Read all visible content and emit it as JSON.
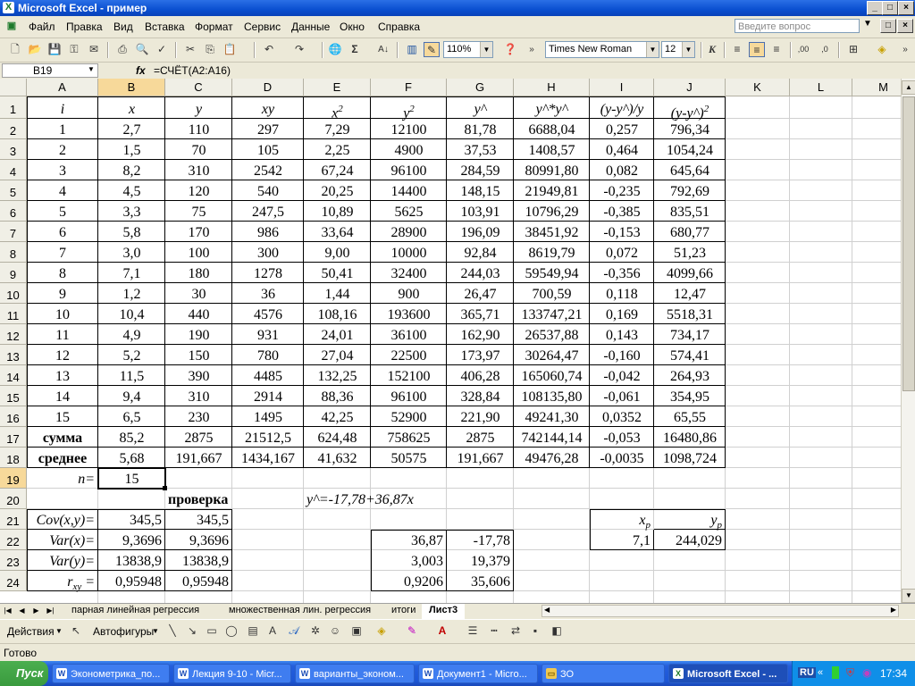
{
  "window": {
    "title": "Microsoft Excel - пример",
    "app_icon": "excel-icon"
  },
  "menu": [
    "Файл",
    "Правка",
    "Вид",
    "Вставка",
    "Формат",
    "Сервис",
    "Данные",
    "Окно",
    "Справка"
  ],
  "help_placeholder": "Введите вопрос",
  "toolbar": {
    "zoom": "110%",
    "font": "Times New Roman",
    "size": "12"
  },
  "formula_bar": {
    "name_box": "B19",
    "fx": "fx",
    "formula": "=СЧЁТ(A2:A16)"
  },
  "columns": [
    "A",
    "B",
    "C",
    "D",
    "E",
    "F",
    "G",
    "H",
    "I",
    "J",
    "K",
    "L",
    "M"
  ],
  "rows": [
    "1",
    "2",
    "3",
    "4",
    "5",
    "6",
    "7",
    "8",
    "9",
    "10",
    "11",
    "12",
    "13",
    "14",
    "15",
    "16",
    "17",
    "18",
    "19",
    "20",
    "21",
    "22",
    "23",
    "24"
  ],
  "table_header": {
    "A": "i",
    "B": "x",
    "C": "y",
    "D": "xy",
    "E": "x",
    "E_sup": "2",
    "F": "y",
    "F_sup": "2",
    "G": "y^",
    "H": "y^*y^",
    "I": "(y-y^)/y",
    "J": "(y-y^)",
    "J_sup": "2"
  },
  "table_rows": [
    [
      "1",
      "2,7",
      "110",
      "297",
      "7,29",
      "12100",
      "81,78",
      "6688,04",
      "0,257",
      "796,34"
    ],
    [
      "2",
      "1,5",
      "70",
      "105",
      "2,25",
      "4900",
      "37,53",
      "1408,57",
      "0,464",
      "1054,24"
    ],
    [
      "3",
      "8,2",
      "310",
      "2542",
      "67,24",
      "96100",
      "284,59",
      "80991,80",
      "0,082",
      "645,64"
    ],
    [
      "4",
      "4,5",
      "120",
      "540",
      "20,25",
      "14400",
      "148,15",
      "21949,81",
      "-0,235",
      "792,69"
    ],
    [
      "5",
      "3,3",
      "75",
      "247,5",
      "10,89",
      "5625",
      "103,91",
      "10796,29",
      "-0,385",
      "835,51"
    ],
    [
      "6",
      "5,8",
      "170",
      "986",
      "33,64",
      "28900",
      "196,09",
      "38451,92",
      "-0,153",
      "680,77"
    ],
    [
      "7",
      "3,0",
      "100",
      "300",
      "9,00",
      "10000",
      "92,84",
      "8619,79",
      "0,072",
      "51,23"
    ],
    [
      "8",
      "7,1",
      "180",
      "1278",
      "50,41",
      "32400",
      "244,03",
      "59549,94",
      "-0,356",
      "4099,66"
    ],
    [
      "9",
      "1,2",
      "30",
      "36",
      "1,44",
      "900",
      "26,47",
      "700,59",
      "0,118",
      "12,47"
    ],
    [
      "10",
      "10,4",
      "440",
      "4576",
      "108,16",
      "193600",
      "365,71",
      "133747,21",
      "0,169",
      "5518,31"
    ],
    [
      "11",
      "4,9",
      "190",
      "931",
      "24,01",
      "36100",
      "162,90",
      "26537,88",
      "0,143",
      "734,17"
    ],
    [
      "12",
      "5,2",
      "150",
      "780",
      "27,04",
      "22500",
      "173,97",
      "30264,47",
      "-0,160",
      "574,41"
    ],
    [
      "13",
      "11,5",
      "390",
      "4485",
      "132,25",
      "152100",
      "406,28",
      "165060,74",
      "-0,042",
      "264,93"
    ],
    [
      "14",
      "9,4",
      "310",
      "2914",
      "88,36",
      "96100",
      "328,84",
      "108135,80",
      "-0,061",
      "354,95"
    ],
    [
      "15",
      "6,5",
      "230",
      "1495",
      "42,25",
      "52900",
      "221,90",
      "49241,30",
      "0,0352",
      "65,55"
    ]
  ],
  "sum_row": [
    "сумма",
    "85,2",
    "2875",
    "21512,5",
    "624,48",
    "758625",
    "2875",
    "742144,14",
    "-0,053",
    "16480,86"
  ],
  "mean_row": [
    "среднее",
    "5,68",
    "191,667",
    "1434,167",
    "41,632",
    "50575",
    "191,667",
    "49476,28",
    "-0,0035",
    "1098,724"
  ],
  "n_label": "n=",
  "n_value": "15",
  "check_label": "проверка",
  "regression": "y^=-17,78+36,87x",
  "stats": [
    {
      "label": "Cov(x,y)=",
      "b": "345,5",
      "c": "345,5"
    },
    {
      "label": "Var(x)=",
      "b": "9,3696",
      "c": "9,3696"
    },
    {
      "label": "Var(y)=",
      "b": "13838,9",
      "c": "13838,9"
    },
    {
      "label": "r",
      "sub": "xy",
      "tail": " =",
      "b": "0,95948",
      "c": "0,95948"
    }
  ],
  "coef_box": [
    [
      "36,87",
      "-17,78"
    ],
    [
      "3,003",
      "19,379"
    ],
    [
      "0,9206",
      "35,606"
    ]
  ],
  "forecast": {
    "xp": "x",
    "xp_sub": "p",
    "yp": "y",
    "yp_sub": "p",
    "xp_val": "7,1",
    "yp_val": "244,029"
  },
  "sheet_tabs": [
    "парная линейная регрессия",
    "множественная лин. регрессия",
    "итоги",
    "Лист3"
  ],
  "draw_toolbar": {
    "actions": "Действия",
    "autoshapes": "Автофигуры"
  },
  "status": "Готово",
  "taskbar": {
    "start": "Пуск",
    "tasks": [
      "Эконометрика_по...",
      "Лекция 9-10 - Micr...",
      "варианты_эконом...",
      "Документ1 - Micro...",
      "ЗО",
      "Microsoft Excel - ..."
    ],
    "lang": "RU",
    "clock": "17:34"
  },
  "colors": {
    "selected_header": "#f7d99a",
    "titlebar": "#0a4fd0",
    "taskbar": "#245edb"
  }
}
